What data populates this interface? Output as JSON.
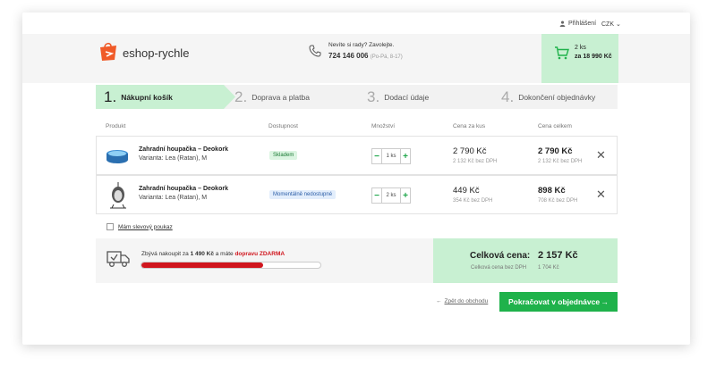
{
  "topbar": {
    "login": "Přihlášení",
    "currency": "CZK"
  },
  "logo": {
    "text": "eshop-rychle"
  },
  "contact": {
    "question": "Nevíte si rady? Zavolejte.",
    "phone": "724 146 006",
    "hours": "(Po-Pá, 8-17)"
  },
  "cart": {
    "count": "2 ks",
    "total": "za 18 990 Kč"
  },
  "steps": [
    {
      "num": "1.",
      "label": "Nákupní košík",
      "active": true
    },
    {
      "num": "2.",
      "label": "Doprava a platba",
      "active": false
    },
    {
      "num": "3.",
      "label": "Dodací údaje",
      "active": false
    },
    {
      "num": "4.",
      "label": "Dokončení objednávky",
      "active": false
    }
  ],
  "table": {
    "headers": [
      "Produkt",
      "Dostupnost",
      "Množství",
      "Cena za kus",
      "Cena celkem"
    ],
    "rows": [
      {
        "name": "Zahradní houpačka – Deokork",
        "variant": "Varianta: Lea (Ratan), M",
        "availability": "Skladem",
        "qty": "1 ks",
        "unit_price": "2 790 Kč",
        "unit_price_ex": "2 132 Kč bez DPH",
        "total_price": "2 790 Kč",
        "total_price_ex": "2 132 Kč bez DPH"
      },
      {
        "name": "Zahradní houpačka – Deokork",
        "variant": "Varianta: Lea (Ratan), M",
        "availability": "Momentálně nedostupné",
        "qty": "2 ks",
        "unit_price": "449 Kč",
        "unit_price_ex": "354 Kč bez DPH",
        "total_price": "898 Kč",
        "total_price_ex": "708 Kč bez DPH"
      }
    ]
  },
  "coupon": {
    "label": "Mám slevový poukaz"
  },
  "shipping": {
    "prefix": "Zbývá nakoupit za ",
    "amount": "1 490 Kč",
    "middle": " a máte ",
    "free": "dopravu ZDARMA",
    "progress_percent": 68
  },
  "summary": {
    "label": "Celková cena:",
    "value": "2 157 Kč",
    "sub_label": "Celková cena bez DPH",
    "sub_value": "1 704 Kč"
  },
  "actions": {
    "back": "Zpět do obchodu",
    "continue": "Pokračovat v objednávce"
  },
  "colors": {
    "accent_green": "#1fb24b",
    "light_green": "#c8f0d2",
    "progress_red": "#d0161e",
    "logo_orange": "#f05a28"
  }
}
